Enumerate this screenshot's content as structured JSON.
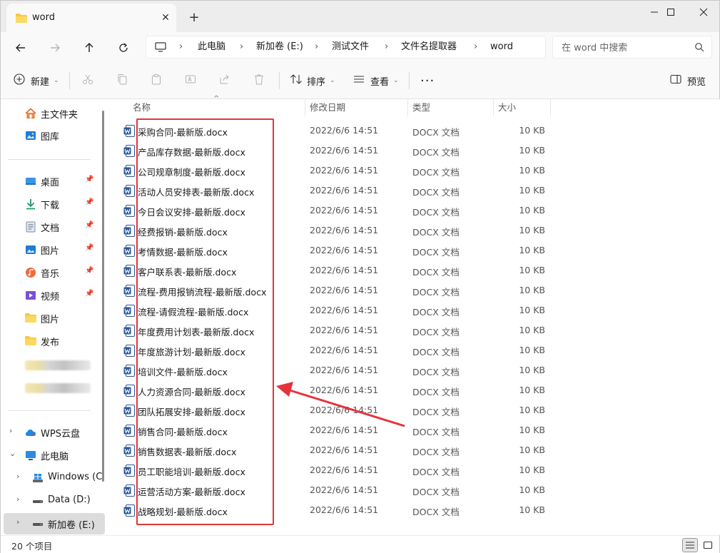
{
  "tab": {
    "title": "word"
  },
  "address": {
    "crumbs": [
      "此电脑",
      "新加卷 (E:)",
      "测试文件",
      "文件名提取器",
      "word"
    ]
  },
  "search": {
    "placeholder": "在 word 中搜索"
  },
  "toolbar": {
    "new_label": "新建",
    "sort_label": "排序",
    "view_label": "查看",
    "preview_label": "预览"
  },
  "sidebar": {
    "quick": [
      {
        "label": "主文件夹",
        "icon": "home-icon"
      },
      {
        "label": "图库",
        "icon": "gallery-icon"
      }
    ],
    "pinned": [
      {
        "label": "桌面",
        "icon": "desktop-icon",
        "pinned": true
      },
      {
        "label": "下载",
        "icon": "download-icon",
        "pinned": true
      },
      {
        "label": "文档",
        "icon": "documents-icon",
        "pinned": true
      },
      {
        "label": "图片",
        "icon": "pictures-icon",
        "pinned": true
      },
      {
        "label": "音乐",
        "icon": "music-icon",
        "pinned": true
      },
      {
        "label": "视频",
        "icon": "video-icon",
        "pinned": true
      },
      {
        "label": "图片",
        "icon": "folder-icon",
        "pinned": false
      },
      {
        "label": "发布",
        "icon": "folder-icon",
        "pinned": false
      }
    ],
    "tree": [
      {
        "label": "WPS云盘",
        "icon": "cloud-icon",
        "expander": "›"
      },
      {
        "label": "此电脑",
        "icon": "pc-icon",
        "expander": "⌄"
      },
      {
        "label": "Windows (C",
        "icon": "windows-drive-icon",
        "expander": "›"
      },
      {
        "label": "Data (D:)",
        "icon": "drive-icon",
        "expander": "›"
      },
      {
        "label": "新加卷 (E:)",
        "icon": "drive-icon",
        "expander": "›"
      }
    ]
  },
  "columns": {
    "name": "名称",
    "date": "修改日期",
    "type": "类型",
    "size": "大小"
  },
  "files": [
    {
      "name": "采购合同-最新版.docx",
      "date": "2022/6/6 14:51",
      "type": "DOCX 文档",
      "size": "10 KB"
    },
    {
      "name": "产品库存数据-最新版.docx",
      "date": "2022/6/6 14:51",
      "type": "DOCX 文档",
      "size": "10 KB"
    },
    {
      "name": "公司规章制度-最新版.docx",
      "date": "2022/6/6 14:51",
      "type": "DOCX 文档",
      "size": "10 KB"
    },
    {
      "name": "活动人员安排表-最新版.docx",
      "date": "2022/6/6 14:51",
      "type": "DOCX 文档",
      "size": "10 KB"
    },
    {
      "name": "今日会议安排-最新版.docx",
      "date": "2022/6/6 14:51",
      "type": "DOCX 文档",
      "size": "10 KB"
    },
    {
      "name": "经费报销-最新版.docx",
      "date": "2022/6/6 14:51",
      "type": "DOCX 文档",
      "size": "10 KB"
    },
    {
      "name": "考情数据-最新版.docx",
      "date": "2022/6/6 14:51",
      "type": "DOCX 文档",
      "size": "10 KB"
    },
    {
      "name": "客户联系表-最新版.docx",
      "date": "2022/6/6 14:51",
      "type": "DOCX 文档",
      "size": "10 KB"
    },
    {
      "name": "流程-费用报销流程-最新版.docx",
      "date": "2022/6/6 14:51",
      "type": "DOCX 文档",
      "size": "10 KB"
    },
    {
      "name": "流程-请假流程-最新版.docx",
      "date": "2022/6/6 14:51",
      "type": "DOCX 文档",
      "size": "10 KB"
    },
    {
      "name": "年度费用计划表-最新版.docx",
      "date": "2022/6/6 14:51",
      "type": "DOCX 文档",
      "size": "10 KB"
    },
    {
      "name": "年度旅游计划-最新版.docx",
      "date": "2022/6/6 14:51",
      "type": "DOCX 文档",
      "size": "10 KB"
    },
    {
      "name": "培训文件-最新版.docx",
      "date": "2022/6/6 14:51",
      "type": "DOCX 文档",
      "size": "10 KB"
    },
    {
      "name": "人力资源合同-最新版.docx",
      "date": "2022/6/6 14:51",
      "type": "DOCX 文档",
      "size": "10 KB"
    },
    {
      "name": "团队拓展安排-最新版.docx",
      "date": "2022/6/6 14:51",
      "type": "DOCX 文档",
      "size": "10 KB"
    },
    {
      "name": "销售合同-最新版.docx",
      "date": "2022/6/6 14:51",
      "type": "DOCX 文档",
      "size": "10 KB"
    },
    {
      "name": "销售数据表-最新版.docx",
      "date": "2022/6/6 14:51",
      "type": "DOCX 文档",
      "size": "10 KB"
    },
    {
      "name": "员工职能培训-最新版.docx",
      "date": "2022/6/6 14:51",
      "type": "DOCX 文档",
      "size": "10 KB"
    },
    {
      "name": "运营活动方案-最新版.docx",
      "date": "2022/6/6 14:51",
      "type": "DOCX 文档",
      "size": "10 KB"
    },
    {
      "name": "战略规划-最新版.docx",
      "date": "2022/6/6 14:51",
      "type": "DOCX 文档",
      "size": "10 KB"
    }
  ],
  "status": {
    "count_text": "20 个项目"
  },
  "colors": {
    "word_blue": "#2b579a",
    "folder_yellow": "#f7c948",
    "annotation_red": "#e5333b"
  }
}
